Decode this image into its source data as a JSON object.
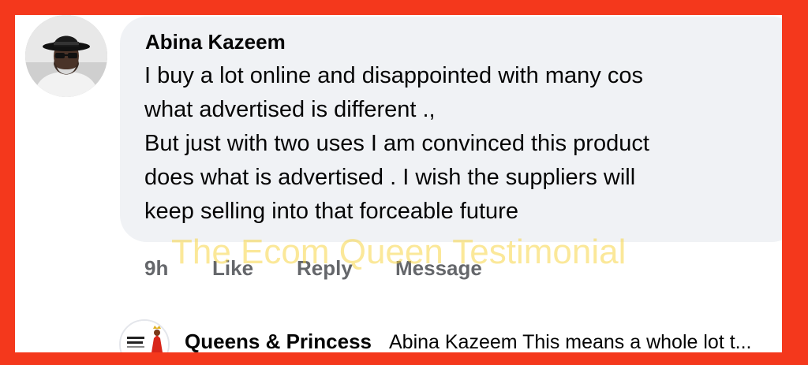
{
  "comment": {
    "author": "Abina Kazeem",
    "lines": [
      "I buy a lot online and disappointed with many cos",
      "what advertised is different .,",
      "But just with two uses I am convinced this product",
      "does what is advertised . I wish the suppliers will",
      "keep selling into that forceable future"
    ],
    "avatar_icon": "profile-photo-man-hat"
  },
  "actions": {
    "time": "9h",
    "like": "Like",
    "reply": "Reply",
    "message": "Message"
  },
  "watermark": "The Ecom Queen Testimonial",
  "reply": {
    "name": "Queens & Princess",
    "text": "Abina Kazeem This means a whole lot t...",
    "avatar_icon": "queens-princess-logo"
  },
  "colors": {
    "frame": "#f4381c",
    "bubble": "#f0f2f5",
    "text": "#050505",
    "secondary_text": "#65676b",
    "watermark": "#f8d646"
  }
}
